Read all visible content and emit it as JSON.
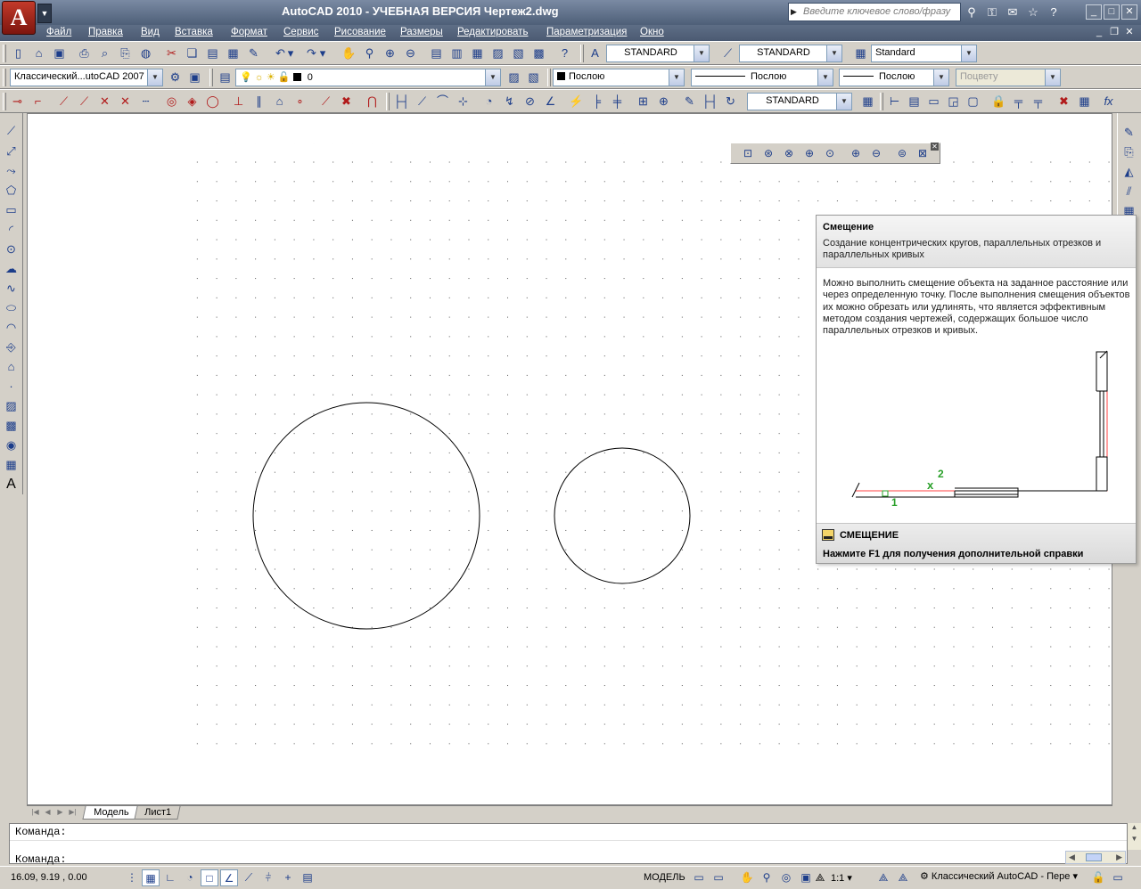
{
  "titlebar": {
    "title": "AutoCAD 2010 - УЧЕБНАЯ ВЕРСИЯ    Чертеж2.dwg",
    "search_placeholder": "Введите ключевое слово/фразу"
  },
  "menu": [
    "Файл",
    "Правка",
    "Вид",
    "Вставка",
    "Формат",
    "Сервис",
    "Рисование",
    "Размеры",
    "Редактировать",
    "Параметризация",
    "Окно"
  ],
  "toolbar_standard": {
    "text_style": "STANDARD",
    "dim_style": "STANDARD",
    "table_style": "Standard"
  },
  "toolbar_layers": {
    "workspace": "Классический...utoCAD 2007",
    "layer": "0",
    "color": "Послою",
    "linetype": "Послою",
    "lineweight": "Послою",
    "plotstyle": "Поцвету"
  },
  "toolbar_dims": {
    "dim_style": "STANDARD"
  },
  "tooltip": {
    "title": "Смещение",
    "short": "Создание концентрических кругов, параллельных отрезков и параллельных кривых",
    "description": "Можно выполнить смещение объекта на заданное расстояние или через определенную точку. После выполнения смещения объектов их можно обрезать или удлинять, что является эффективным методом создания чертежей, содержащих большое число параллельных отрезков и кривых.",
    "label_1": "1",
    "label_2": "2",
    "command": "СМЕЩЕНИЕ",
    "help": "Нажмите F1 для получения дополнительной справки"
  },
  "tabs": [
    "Модель",
    "Лист1"
  ],
  "command": {
    "line1": "Команда:",
    "line2": "Команда:"
  },
  "status": {
    "coords": "16.09, 9.19 , 0.00",
    "model": "МОДЕЛЬ",
    "scale": "1:1",
    "workspace": "Классический AutoCAD - Пере"
  },
  "colors": {
    "accent_red": "#e03030",
    "point_green": "#2aa02a"
  }
}
